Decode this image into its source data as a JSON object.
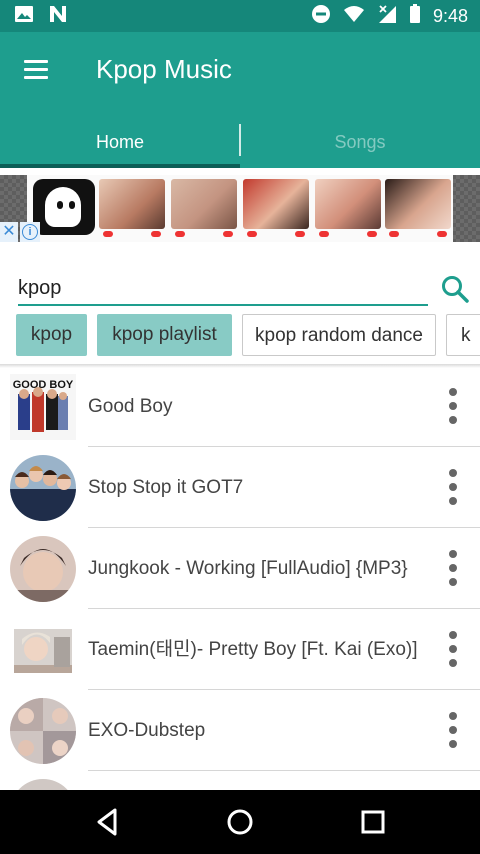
{
  "status_bar": {
    "time": "9:48",
    "left_icons": [
      "image-icon",
      "n-notification-icon"
    ],
    "right_icons": [
      "do-not-disturb-icon",
      "wifi-icon",
      "signal-icon",
      "battery-icon"
    ]
  },
  "app_bar": {
    "title": "Kpop Music",
    "menu_icon": "hamburger-menu-icon",
    "color": "#1e9e8e"
  },
  "tabs": [
    {
      "label": "Home",
      "selected": true
    },
    {
      "label": "Songs",
      "selected": false
    }
  ],
  "ad": {
    "logo_icon": "ghost-app-icon",
    "close_icon": "close-icon",
    "info_icon": "info-icon"
  },
  "search": {
    "value": "kpop",
    "placeholder": "",
    "icon": "search-icon"
  },
  "chips": [
    {
      "label": "kpop",
      "filled": true
    },
    {
      "label": "kpop playlist",
      "filled": true
    },
    {
      "label": "kpop random dance",
      "filled": false
    },
    {
      "label": "k",
      "filled": false
    }
  ],
  "songs": [
    {
      "title": "Good Boy"
    },
    {
      "title": "Stop Stop it GOT7"
    },
    {
      "title": "Jungkook - Working [FullAudio] {MP3}"
    },
    {
      "title": "Taemin(태민)- Pretty Boy [Ft. Kai (Exo)]"
    },
    {
      "title": "EXO-Dubstep"
    }
  ],
  "nav_bar": {
    "back_icon": "back-triangle-icon",
    "home_icon": "home-circle-icon",
    "recents_icon": "recents-square-icon"
  },
  "colors": {
    "status_bar": "#15877a",
    "primary": "#1e9e8e",
    "tab_indicator": "#0c5f57",
    "chip_filled": "#88cbc5"
  }
}
